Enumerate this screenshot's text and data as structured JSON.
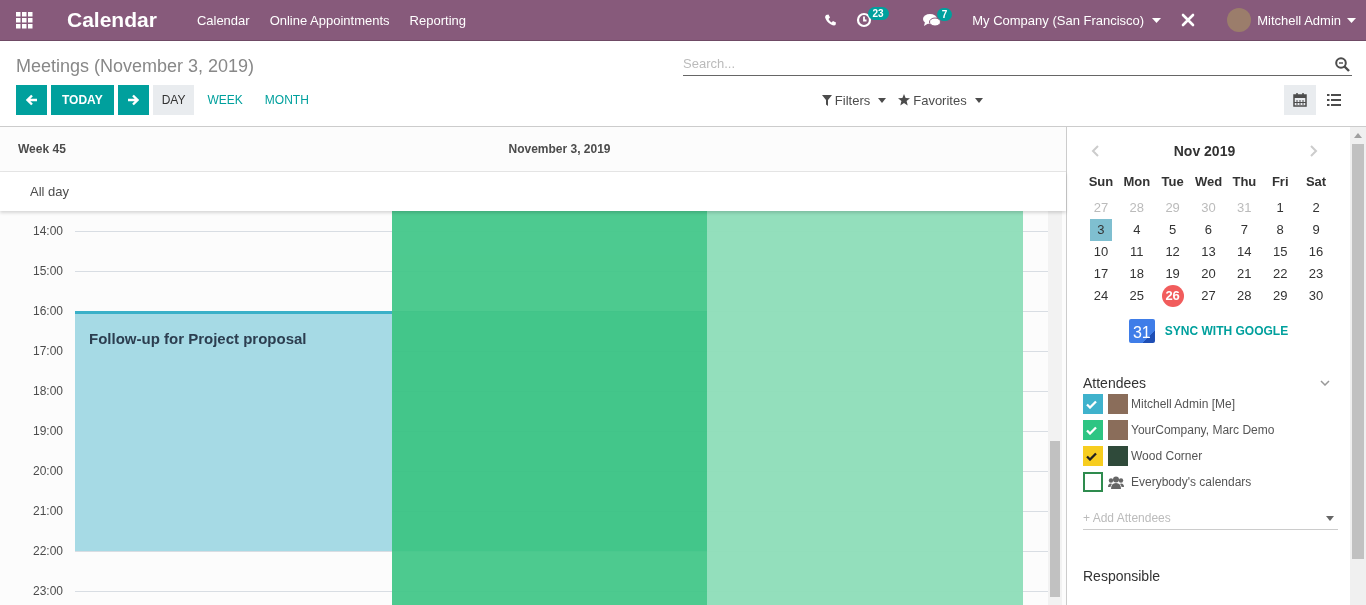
{
  "navbar": {
    "app_name": "Calendar",
    "menu": [
      "Calendar",
      "Online Appointments",
      "Reporting"
    ],
    "activity_count": "23",
    "message_count": "7",
    "company": "My Company (San Francisco)",
    "user": "Mitchell Admin"
  },
  "control_panel": {
    "breadcrumb": "Meetings (November 3, 2019)",
    "search": {
      "placeholder": "Search..."
    },
    "today": "TODAY",
    "scales": [
      {
        "label": "DAY",
        "selected": true
      },
      {
        "label": "WEEK",
        "selected": false
      },
      {
        "label": "MONTH",
        "selected": false
      }
    ],
    "filters": "Filters",
    "favorites": "Favorites",
    "views": [
      {
        "kind": "calendar",
        "selected": true
      },
      {
        "kind": "list",
        "selected": false
      }
    ]
  },
  "calendar": {
    "week": "Week 45",
    "date": "November 3, 2019",
    "all_day": "All day",
    "hours": [
      "14:00",
      "15:00",
      "16:00",
      "17:00",
      "18:00",
      "19:00",
      "20:00",
      "21:00",
      "22:00",
      "23:00"
    ],
    "events": [
      {
        "title": "Follow-up for Project proposal",
        "color": "#a6dae5"
      },
      {
        "color": "#46c88b"
      },
      {
        "color": "#8fdeb9"
      }
    ]
  },
  "sidebar": {
    "mini_calendar": {
      "title": "Nov 2019",
      "weekdays": [
        "Sun",
        "Mon",
        "Tue",
        "Wed",
        "Thu",
        "Fri",
        "Sat"
      ],
      "days": [
        {
          "label": "27",
          "outside": true,
          "selected": false,
          "today": false
        },
        {
          "label": "28",
          "outside": true,
          "selected": false,
          "today": false
        },
        {
          "label": "29",
          "outside": true,
          "selected": false,
          "today": false
        },
        {
          "label": "30",
          "outside": true,
          "selected": false,
          "today": false
        },
        {
          "label": "31",
          "outside": true,
          "selected": false,
          "today": false
        },
        {
          "label": "1",
          "outside": false,
          "selected": false,
          "today": false
        },
        {
          "label": "2",
          "outside": false,
          "selected": false,
          "today": false
        },
        {
          "label": "3",
          "outside": false,
          "selected": true,
          "today": false
        },
        {
          "label": "4",
          "outside": false,
          "selected": false,
          "today": false
        },
        {
          "label": "5",
          "outside": false,
          "selected": false,
          "today": false
        },
        {
          "label": "6",
          "outside": false,
          "selected": false,
          "today": false
        },
        {
          "label": "7",
          "outside": false,
          "selected": false,
          "today": false
        },
        {
          "label": "8",
          "outside": false,
          "selected": false,
          "today": false
        },
        {
          "label": "9",
          "outside": false,
          "selected": false,
          "today": false
        },
        {
          "label": "10",
          "outside": false,
          "selected": false,
          "today": false
        },
        {
          "label": "11",
          "outside": false,
          "selected": false,
          "today": false
        },
        {
          "label": "12",
          "outside": false,
          "selected": false,
          "today": false
        },
        {
          "label": "13",
          "outside": false,
          "selected": false,
          "today": false
        },
        {
          "label": "14",
          "outside": false,
          "selected": false,
          "today": false
        },
        {
          "label": "15",
          "outside": false,
          "selected": false,
          "today": false
        },
        {
          "label": "16",
          "outside": false,
          "selected": false,
          "today": false
        },
        {
          "label": "17",
          "outside": false,
          "selected": false,
          "today": false
        },
        {
          "label": "18",
          "outside": false,
          "selected": false,
          "today": false
        },
        {
          "label": "19",
          "outside": false,
          "selected": false,
          "today": false
        },
        {
          "label": "20",
          "outside": false,
          "selected": false,
          "today": false
        },
        {
          "label": "21",
          "outside": false,
          "selected": false,
          "today": false
        },
        {
          "label": "22",
          "outside": false,
          "selected": false,
          "today": false
        },
        {
          "label": "23",
          "outside": false,
          "selected": false,
          "today": false
        },
        {
          "label": "24",
          "outside": false,
          "selected": false,
          "today": false
        },
        {
          "label": "25",
          "outside": false,
          "selected": false,
          "today": false
        },
        {
          "label": "26",
          "outside": false,
          "selected": false,
          "today": true
        },
        {
          "label": "27",
          "outside": false,
          "selected": false,
          "today": false
        },
        {
          "label": "28",
          "outside": false,
          "selected": false,
          "today": false
        },
        {
          "label": "29",
          "outside": false,
          "selected": false,
          "today": false
        },
        {
          "label": "30",
          "outside": false,
          "selected": false,
          "today": false
        }
      ]
    },
    "sync_icon": "31",
    "sync": "SYNC WITH **GOOGLE**",
    "attendees": {
      "title": "Attendees",
      "items": [
        {
          "name": "Mitchell Admin [Me]",
          "kind": "person",
          "checked": true,
          "color": "#3fb2cc"
        },
        {
          "name": "YourCompany, Marc Demo",
          "kind": "person",
          "checked": true,
          "color": "#2ec583"
        },
        {
          "name": "Wood Corner",
          "kind": "company",
          "checked": true,
          "color": "#f7cd1f"
        },
        {
          "name": "Everybody's calendars",
          "kind": "everybody",
          "checked": false,
          "color": "#2e8b4e"
        }
      ],
      "add_placeholder": "+ Add Attendees"
    },
    "responsible": "Responsible"
  }
}
